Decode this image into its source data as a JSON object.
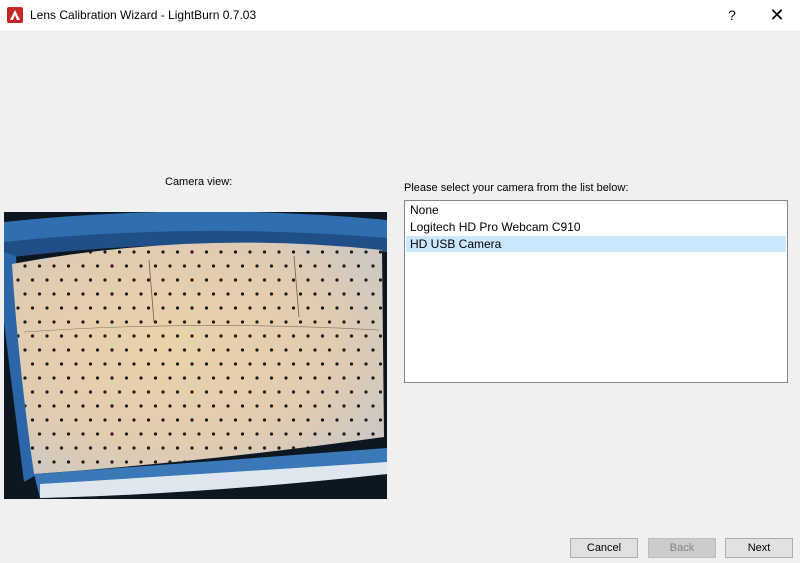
{
  "window": {
    "title": "Lens Calibration Wizard - LightBurn 0.7.03",
    "help_glyph": "?",
    "close_glyph": "✕"
  },
  "camera_view": {
    "label": "Camera view:"
  },
  "camera_select": {
    "label": "Please select your camera from the list below:",
    "options": [
      {
        "label": "None",
        "selected": false
      },
      {
        "label": "Logitech HD Pro Webcam C910",
        "selected": false
      },
      {
        "label": "HD USB Camera",
        "selected": true
      }
    ]
  },
  "buttons": {
    "cancel": "Cancel",
    "back": "Back",
    "next": "Next"
  },
  "colors": {
    "selection": "#cce8ff",
    "frame_blue": "#2f6fb0"
  }
}
